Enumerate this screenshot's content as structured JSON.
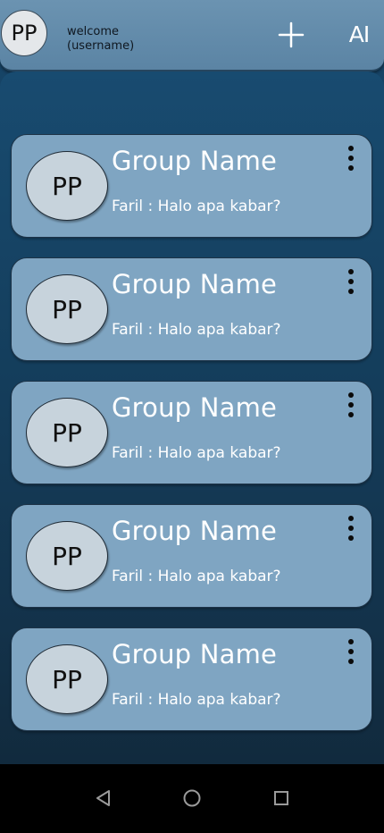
{
  "header": {
    "avatar_initials": "PP",
    "welcome_line1": "welcome",
    "welcome_line2": "(username)",
    "ai_label": "AI",
    "icons": [
      "plus-icon",
      "ai-icon"
    ]
  },
  "groups": [
    {
      "avatar_initials": "PP",
      "name": "Group Name",
      "last_message": "Faril : Halo apa kabar?"
    },
    {
      "avatar_initials": "PP",
      "name": "Group Name",
      "last_message": "Faril : Halo apa kabar?"
    },
    {
      "avatar_initials": "PP",
      "name": "Group Name",
      "last_message": "Faril : Halo apa kabar?"
    },
    {
      "avatar_initials": "PP",
      "name": "Group Name",
      "last_message": "Faril : Halo apa kabar?"
    },
    {
      "avatar_initials": "PP",
      "name": "Group Name",
      "last_message": "Faril : Halo apa kabar?"
    }
  ],
  "navbar": {
    "icons": [
      "back-triangle-icon",
      "home-circle-icon",
      "recents-square-icon"
    ]
  },
  "colors": {
    "header": "#6b93b1",
    "card": "#7fa5c2",
    "background": "#153b58",
    "text_light": "#ffffff"
  }
}
